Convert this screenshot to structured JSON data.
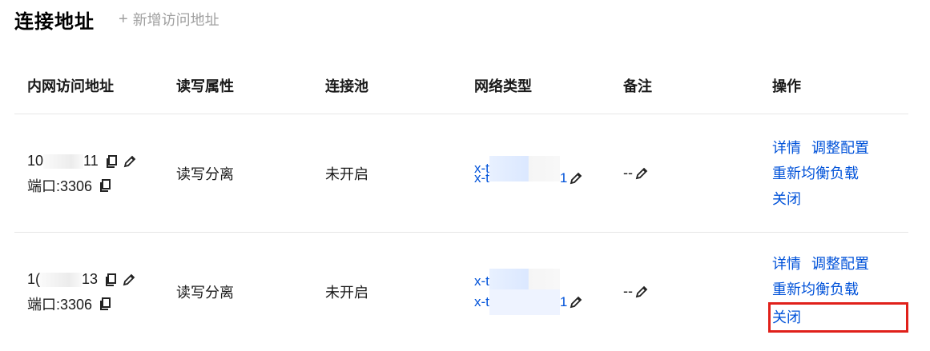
{
  "header": {
    "title": "连接地址",
    "add_label": "新增访问地址"
  },
  "columns": [
    "内网访问地址",
    "读写属性",
    "连接池",
    "网络类型",
    "备注",
    "操作"
  ],
  "rows": [
    {
      "ip_prefix": "10",
      "ip_suffix": "11",
      "port": "端口:3306",
      "rw": "读写分离",
      "pool": "未开启",
      "net_line1": "x-t",
      "net_line2_prefix": "x-t",
      "net_line2_suffix": "1",
      "remark": "--",
      "ops": {
        "detail": "详情",
        "adjust": "调整配置",
        "rebalance": "重新均衡负载",
        "close": "关闭"
      }
    },
    {
      "ip_prefix": "1(",
      "ip_suffix": "13",
      "port": "端口:3306",
      "rw": "读写分离",
      "pool": "未开启",
      "net_line1": "x-t",
      "net_line2_prefix": "x-t",
      "net_line2_suffix": "1",
      "remark": "--",
      "ops": {
        "detail": "详情",
        "adjust": "调整配置",
        "rebalance": "重新均衡负载",
        "close": "关闭"
      }
    }
  ],
  "icons": {
    "copy": "copy-icon",
    "edit": "pencil-icon",
    "add": "plus-icon"
  },
  "colors": {
    "link": "#0052d9",
    "highlight": "#e0201a",
    "muted": "#a0a0a0"
  }
}
